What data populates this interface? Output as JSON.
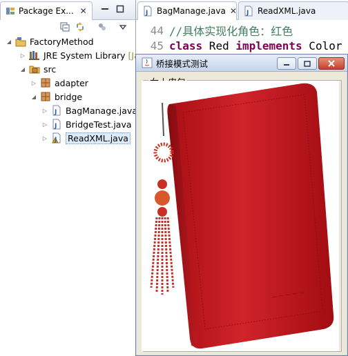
{
  "package_explorer": {
    "tab_title": "Package Ex...",
    "tree": [
      {
        "label": "FactoryMethod",
        "level": 0,
        "expanded": true,
        "icon": "java-project-icon"
      },
      {
        "label": "JRE System Library",
        "suffix": "[Jav",
        "level": 1,
        "expanded": false,
        "icon": "library-icon"
      },
      {
        "label": "src",
        "level": 1,
        "expanded": true,
        "icon": "source-folder-icon"
      },
      {
        "label": "adapter",
        "level": 2,
        "expanded": false,
        "icon": "package-icon"
      },
      {
        "label": "bridge",
        "level": 2,
        "expanded": true,
        "icon": "package-icon"
      },
      {
        "label": "BagManage.java",
        "level": 3,
        "expanded": false,
        "icon": "java-file-icon"
      },
      {
        "label": "BridgeTest.java",
        "level": 3,
        "expanded": false,
        "icon": "java-file-icon"
      },
      {
        "label": "ReadXML.java",
        "level": 3,
        "expanded": false,
        "icon": "java-file-icon",
        "selected": true
      }
    ]
  },
  "editor": {
    "tabs": [
      {
        "label": "BagManage.java",
        "active": true
      },
      {
        "label": "ReadXML.java",
        "active": false
      }
    ],
    "lines": [
      {
        "num": "44",
        "text": "//具体实现化角色：红色"
      },
      {
        "num": "45",
        "kw1": "class",
        "name": " Red ",
        "kw2": "implements",
        "rest": " Color"
      }
    ]
  },
  "java_window": {
    "title": "桥接模式测试",
    "group_title": "女士皮包",
    "buttons": [
      "minimize",
      "maximize",
      "close"
    ]
  },
  "colors": {
    "comment": "#3f7f5f",
    "keyword": "#7f0055",
    "wallet_red": "#c8181e"
  }
}
